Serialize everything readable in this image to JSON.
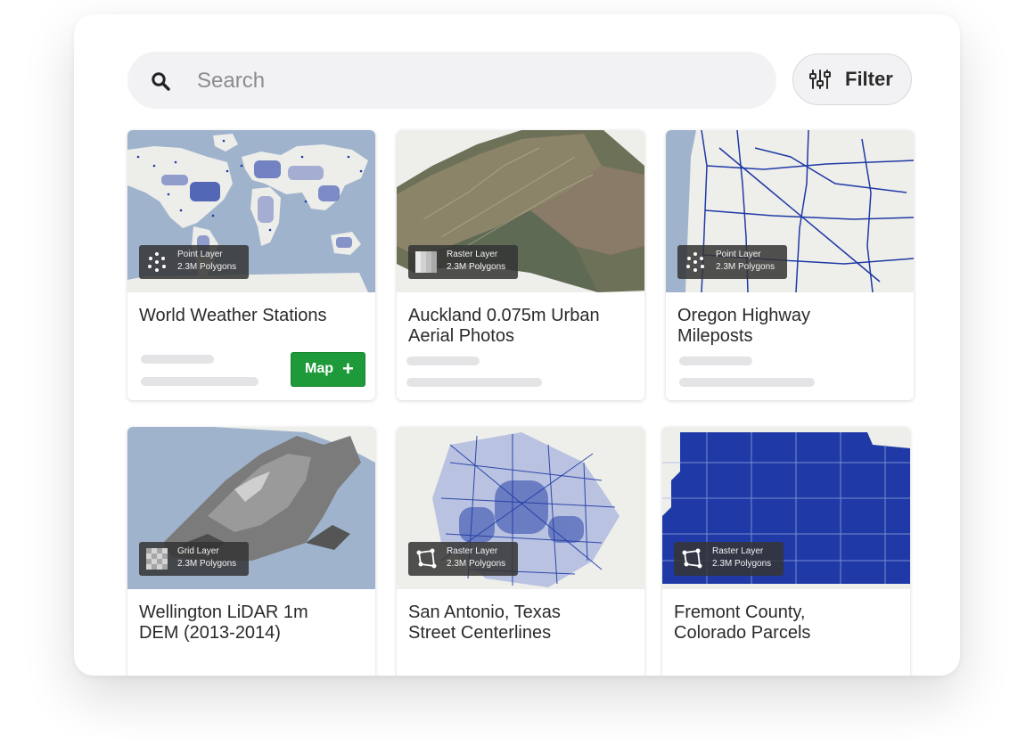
{
  "search": {
    "placeholder": "Search",
    "icon": "search-icon"
  },
  "filter": {
    "label": "Filter",
    "icon": "sliders-icon"
  },
  "colors": {
    "map_button": "#1e9a3b",
    "water": "#9fb3cc",
    "land": "#eeeeea",
    "feature": "#1f3aa6"
  },
  "cards": [
    {
      "title": "World Weather Stations",
      "layer_type": "Point Layer",
      "count": "2.3M Polygons",
      "layer_icon": "points-icon",
      "action": {
        "label": "Map",
        "icon": "plus-icon"
      }
    },
    {
      "title": "Auckland 0.075m Urban Aerial Photos",
      "layer_type": "Raster Layer",
      "count": "2.3M Polygons",
      "layer_icon": "raster-icon"
    },
    {
      "title": "Oregon Highway Mileposts",
      "layer_type": "Point Layer",
      "count": "2.3M Polygons",
      "layer_icon": "points-icon"
    },
    {
      "title": "Wellington LiDAR 1m DEM (2013-2014)",
      "layer_type": "Grid Layer",
      "count": "2.3M Polygons",
      "layer_icon": "grid-icon"
    },
    {
      "title": "San Antonio, Texas Street Centerlines",
      "layer_type": "Raster Layer",
      "count": "2.3M Polygons",
      "layer_icon": "polygon-icon"
    },
    {
      "title": "Fremont County, Colorado Parcels",
      "layer_type": "Raster Layer",
      "count": "2.3M Polygons",
      "layer_icon": "polygon-icon"
    }
  ]
}
